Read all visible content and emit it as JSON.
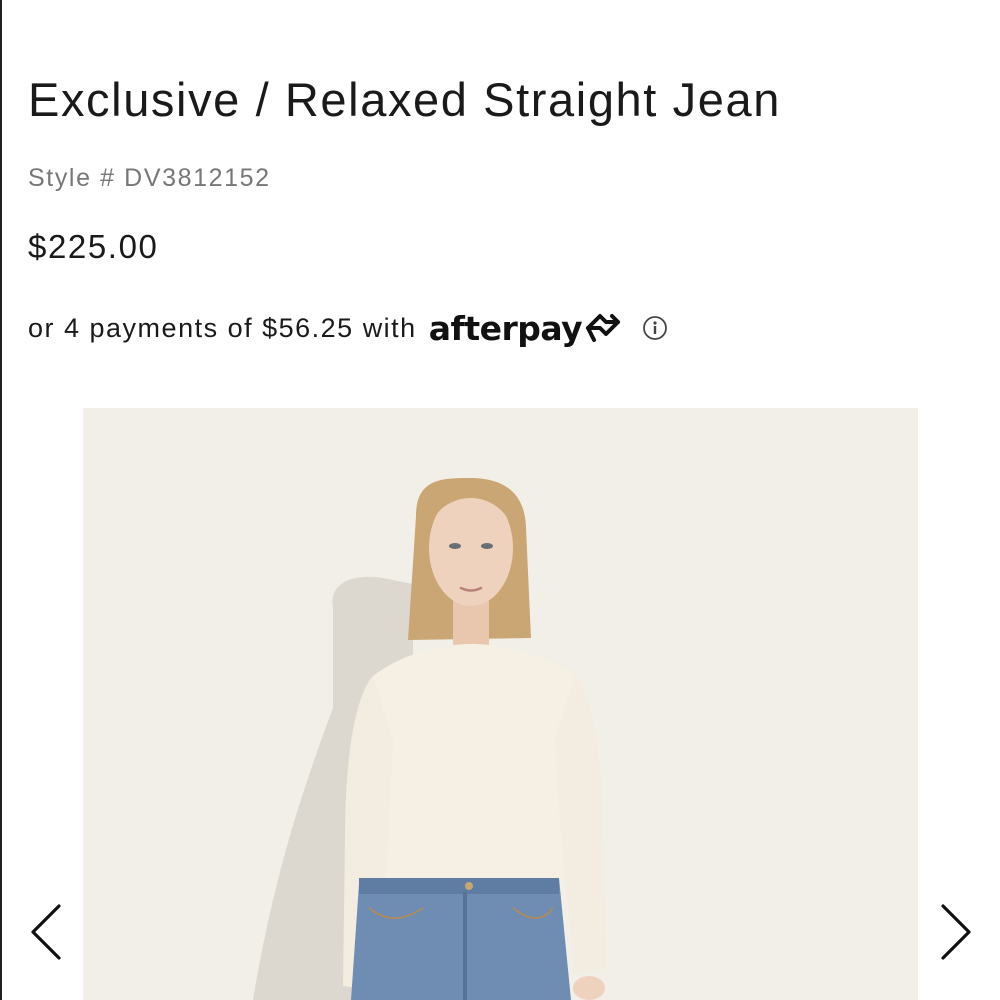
{
  "product": {
    "title": "Exclusive / Relaxed Straight Jean",
    "style_number": "Style # DV3812152",
    "price": "$225.00"
  },
  "afterpay": {
    "message": "or 4 payments of $56.25 with",
    "logo_text": "afterpay",
    "logo_icon": "afterpay-arrows-icon",
    "info_icon": "info-icon"
  },
  "gallery": {
    "image": "model-wearing-cream-blouse-and-blue-jeans",
    "prev_icon": "chevron-left-icon",
    "next_icon": "chevron-right-icon"
  },
  "colors": {
    "text": "#1a1a1a",
    "muted": "#777777",
    "gallery_bg": "#f2efe9",
    "denim": "#6f8db3"
  }
}
